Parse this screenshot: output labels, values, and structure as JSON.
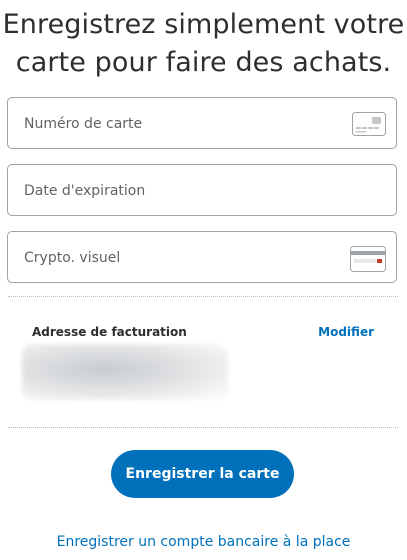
{
  "header": {
    "title_line1": "Enregistrez simplement votre",
    "title_line2": "carte pour faire des achats."
  },
  "form": {
    "card_number_placeholder": "Numéro de carte",
    "expiry_placeholder": "Date d'expiration",
    "cvv_placeholder": "Crypto. visuel"
  },
  "billing": {
    "label": "Adresse de facturation",
    "modify_label": "Modifier"
  },
  "actions": {
    "save_card_label": "Enregistrer la carte",
    "bank_account_link": "Enregistrer un compte bancaire à la place"
  },
  "icons": {
    "card": "card-front-icon",
    "cvv": "card-back-icon"
  },
  "colors": {
    "primary": "#0070ba",
    "text": "#2c2e2f",
    "border": "#9da3a6"
  }
}
